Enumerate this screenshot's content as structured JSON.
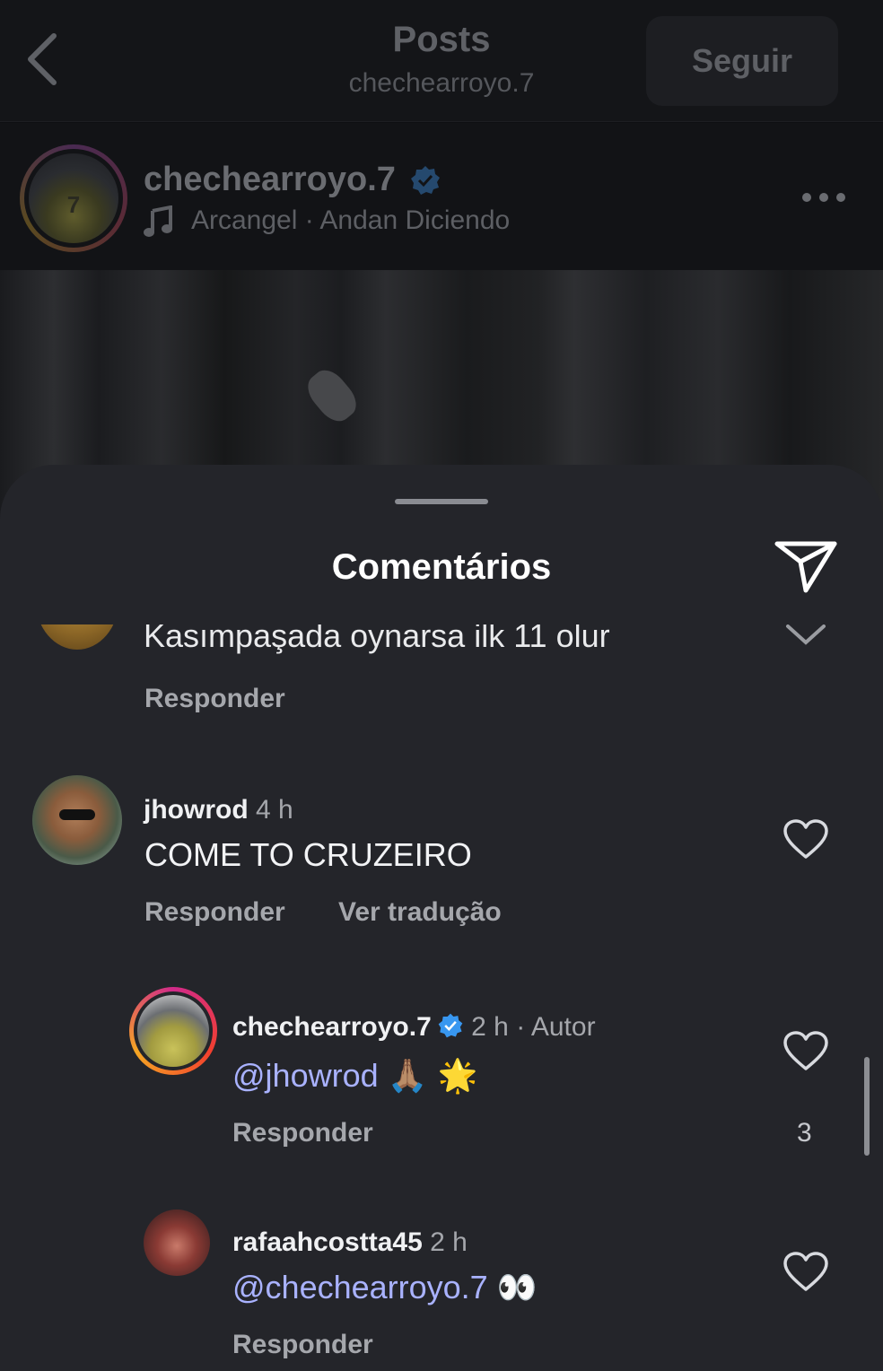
{
  "header": {
    "back_icon": "chevron-left-icon",
    "title": "Posts",
    "subtitle": "chechearroyo.7",
    "follow_label": "Seguir"
  },
  "post": {
    "username": "chechearroyo.7",
    "verified": true,
    "music_icon": "music-note-icon",
    "song": "Arcangel · Andan Diciendo",
    "more_icon": "more-horizontal-icon"
  },
  "sheet": {
    "title": "Comentários",
    "share_icon": "send-icon"
  },
  "comments": [
    {
      "partial_text": "Kasımpaşada oynarsa ilk 11 olur",
      "reply_label": "Responder"
    },
    {
      "username": "jhowrod",
      "time": "4 h",
      "text": "COME TO CRUZEIRO",
      "reply_label": "Responder",
      "translate_label": "Ver tradução"
    },
    {
      "username": "chechearroyo.7",
      "verified": true,
      "time": "2 h",
      "author_label": "Autor",
      "mention": "@jhowrod",
      "emoji": "🙏🏽 🌟",
      "reply_label": "Responder",
      "likes": "3"
    },
    {
      "username": "rafaahcostta45",
      "time": "2 h",
      "mention": "@chechearroyo.7",
      "emoji": "👀",
      "reply_label": "Responder"
    }
  ],
  "colors": {
    "sheet_bg": "#24252a",
    "mention": "#a9b2ff",
    "verified": "#3897f0"
  }
}
